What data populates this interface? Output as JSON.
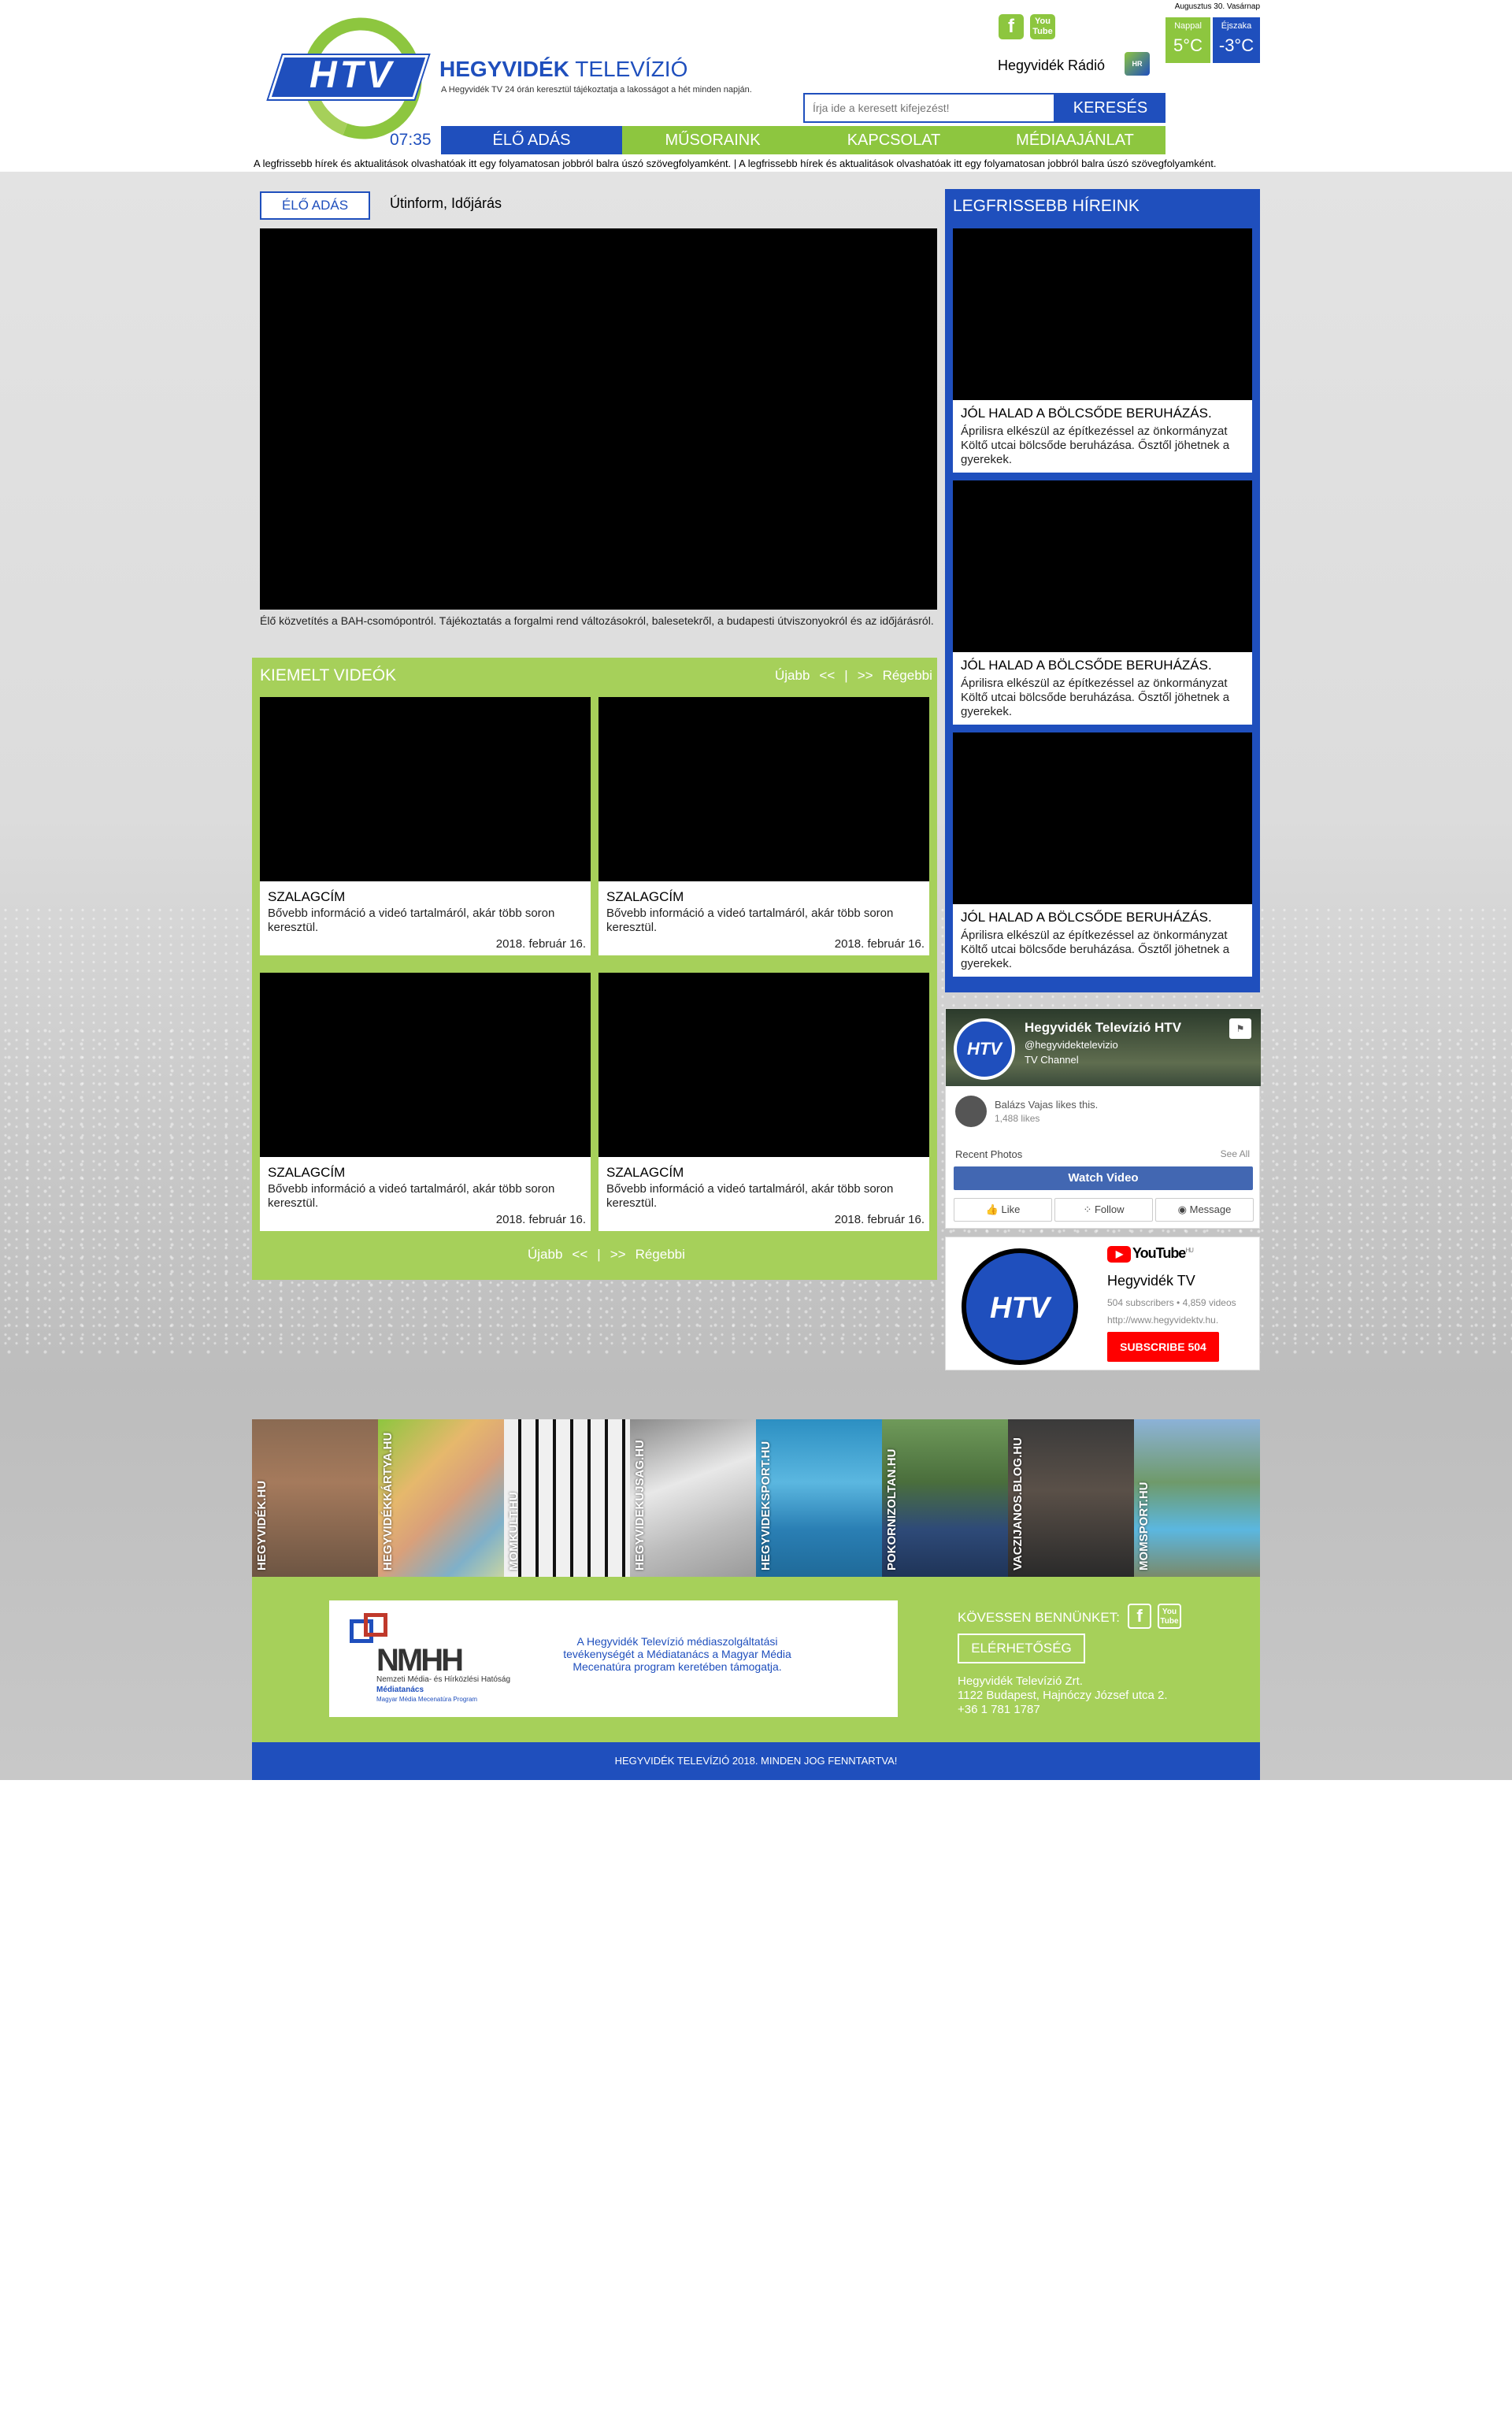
{
  "header": {
    "logo_text": "HTV",
    "title_bold": "HEGYVIDÉK",
    "title_rest": " TELEVÍZIÓ",
    "subtitle": "A Hegyvidék TV 24 órán keresztül tájékoztatja a lakosságot a hét minden napján.",
    "social": {
      "facebook": "f",
      "youtube": "You Tube"
    },
    "radio_label": "Hegyvidék Rádió",
    "radio_icon": "HR",
    "date": "Augusztus 30. Vasárnap",
    "weather": {
      "day_label": "Nappal",
      "day_temp": "5°C",
      "night_label": "Éjszaka",
      "night_temp": "-3°C"
    },
    "search": {
      "placeholder": "Írja ide a keresett kifejezést!",
      "button": "KERESÉS"
    },
    "clock": "07:35"
  },
  "nav": {
    "live": "ÉLŐ ADÁS",
    "shows": "MŰSORAINK",
    "contact": "KAPCSOLAT",
    "media": "MÉDIAAJÁNLAT"
  },
  "ticker": "A legfrissebb hírek és aktualitások olvashatóak itt egy folyamatosan jobbról balra úszó szövegfolyamként.    |    A legfrissebb hírek és aktualitások olvashatóak itt egy folyamatosan jobbról balra úszó szövegfolyamként.",
  "live": {
    "tab_active": "ÉLŐ ADÁS",
    "tab_other": "Útinform, Időjárás",
    "description": "Élő közvetítés a BAH-csomópontról. Tájékoztatás a forgalmi rend változásokról, balesetekről, a budapesti útviszonyokról és az időjárásról."
  },
  "featured": {
    "title": "KIEMELT VIDEÓK",
    "pager": {
      "newer": "Újabb",
      "prev": "<<",
      "sep": "|",
      "next": ">>",
      "older": "Régebbi"
    },
    "videos": [
      {
        "title": "SZALAGCÍM",
        "desc": "Bővebb információ a videó tartalmáról, akár több soron keresztül.",
        "date": "2018. február 16."
      },
      {
        "title": "SZALAGCÍM",
        "desc": "Bővebb információ a videó tartalmáról, akár több soron keresztül.",
        "date": "2018. február 16."
      },
      {
        "title": "SZALAGCÍM",
        "desc": "Bővebb információ a videó tartalmáról, akár több soron keresztül.",
        "date": "2018. február 16."
      },
      {
        "title": "SZALAGCÍM",
        "desc": "Bővebb információ a videó tartalmáról, akár több soron keresztül.",
        "date": "2018. február 16."
      }
    ]
  },
  "news": {
    "title": "LEGFRISSEBB HÍREINK",
    "items": [
      {
        "title": "JÓL HALAD A BÖLCSŐDE BERUHÁZÁS.",
        "desc": "Áprilisra elkészül az építkezéssel az önkormányzat Költő utcai bölcsőde beruházása. Ősztől jöhetnek a gyerekek."
      },
      {
        "title": "JÓL HALAD A BÖLCSŐDE BERUHÁZÁS.",
        "desc": "Áprilisra elkészül az építkezéssel az önkormányzat Költő utcai bölcsőde beruházása. Ősztől jöhetnek a gyerekek."
      },
      {
        "title": "JÓL HALAD A BÖLCSŐDE BERUHÁZÁS.",
        "desc": "Áprilisra elkészül az építkezéssel az önkormányzat Költő utcai bölcsőde beruházása. Ősztől jöhetnek a gyerekek."
      }
    ]
  },
  "facebook": {
    "page_name": "Hegyvidék Televízió HTV",
    "handle": "@hegyvidektelevizio",
    "type": "TV Channel",
    "avatar": "HTV",
    "liker": "Balázs Vajas likes this.",
    "likes": "1,488 likes",
    "recent_photos": "Recent Photos",
    "see_all": "See All",
    "watch": "Watch Video",
    "like": "Like",
    "follow": "Follow",
    "message": "Message"
  },
  "youtube": {
    "logo": "YouTube",
    "logo_region": "HU",
    "channel": "Hegyvidék TV",
    "stats": "504 subscribers • 4,859 videos",
    "url": "http://www.hegyvidektv.hu.",
    "subscribe": "SUBSCRIBE  504",
    "avatar": "HTV"
  },
  "partners": [
    "HEGYVIDÉK.HU",
    "HEGYVIDÉKKÁRTYA.HU",
    "MOMKULT.HU",
    "HEGYVIDEKUJSAG.HU",
    "HEGYVIDEKSPORT.HU",
    "POKORNIZOLTAN.HU",
    "VACZIJANOS.BLOG.HU",
    "MOMSPORT.HU"
  ],
  "footer": {
    "nmhh_mark": "NMHH",
    "nmhh_name": "Nemzeti Média- és Hírközlési Hatóság",
    "nmhh_sub1": "Médiatanács",
    "nmhh_sub2": "Magyar Média Mecenatúra Program",
    "support_text": "A Hegyvidék Televízió médiaszolgáltatási tevékenységét a Médiatanács a Magyar Média Mecenatúra program keretében támogatja.",
    "follow": "KÖVESSEN BENNÜNKET:",
    "contact_button": "ELÉRHETŐSÉG",
    "company": "Hegyvidék Televízió Zrt.",
    "address": "1122 Budapest, Hajnóczy József utca 2.",
    "phone": "+36 1 781 1787",
    "copyright": "HEGYVIDÉK TELEVÍZIÓ 2018. MINDEN JOG FENNTARTVA!"
  },
  "colors": {
    "blue": "#1f4fbd",
    "green": "#8dc63f",
    "light_green": "#a6d05a"
  }
}
